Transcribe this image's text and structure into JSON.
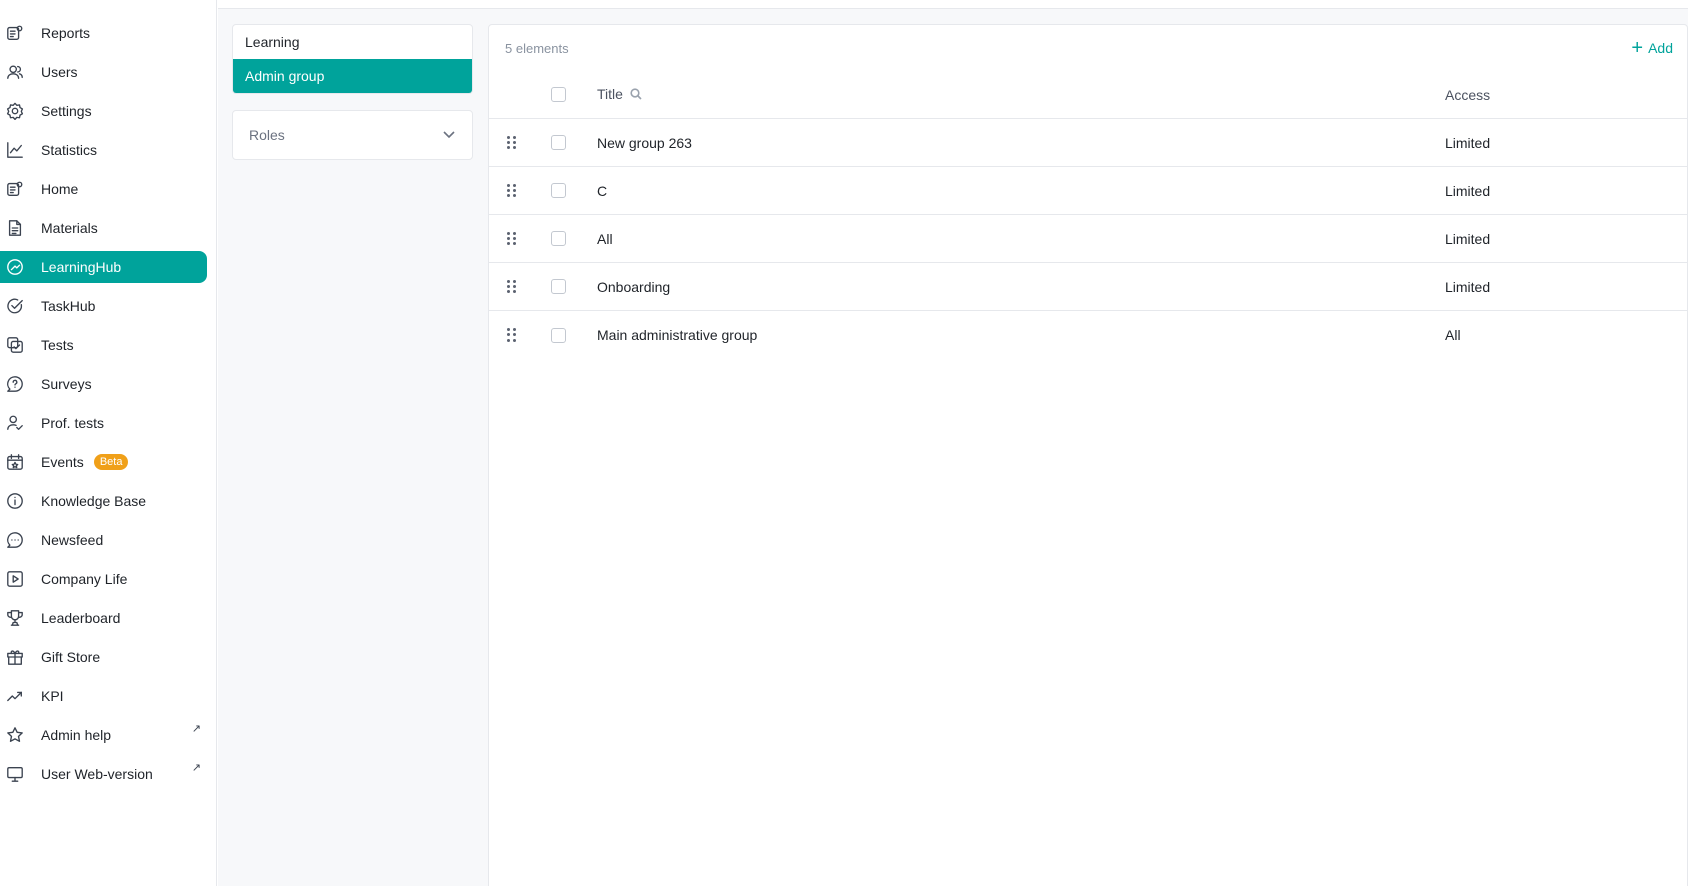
{
  "sidebar": {
    "items": [
      {
        "label": "Reports",
        "icon": "reports-icon"
      },
      {
        "label": "Users",
        "icon": "users-icon"
      },
      {
        "label": "Settings",
        "icon": "gear-icon"
      },
      {
        "label": "Statistics",
        "icon": "line-chart-icon"
      },
      {
        "label": "Home",
        "icon": "home-icon"
      },
      {
        "label": "Materials",
        "icon": "document-icon"
      },
      {
        "label": "LearningHub",
        "icon": "learninghub-icon",
        "active": true
      },
      {
        "label": "TaskHub",
        "icon": "check-circle-icon"
      },
      {
        "label": "Tests",
        "icon": "tests-icon"
      },
      {
        "label": "Surveys",
        "icon": "question-bubble-icon"
      },
      {
        "label": "Prof. tests",
        "icon": "user-check-icon"
      },
      {
        "label": "Events",
        "icon": "calendar-star-icon",
        "badge": "Beta"
      },
      {
        "label": "Knowledge Base",
        "icon": "info-icon"
      },
      {
        "label": "Newsfeed",
        "icon": "chat-bubble-icon"
      },
      {
        "label": "Company Life",
        "icon": "play-icon"
      },
      {
        "label": "Leaderboard",
        "icon": "trophy-icon"
      },
      {
        "label": "Gift Store",
        "icon": "gift-icon"
      },
      {
        "label": "KPI",
        "icon": "trend-up-icon"
      },
      {
        "label": "Admin help",
        "icon": "star-icon",
        "external": "↗"
      },
      {
        "label": "User Web-version",
        "icon": "monitor-icon",
        "external": "↗"
      }
    ]
  },
  "groups": {
    "items": [
      "Learning",
      "Admin group"
    ],
    "active_index": 1,
    "roles_label": "Roles"
  },
  "table": {
    "count_label": "5 elements",
    "add_label": "Add",
    "columns": {
      "title": "Title",
      "access": "Access"
    },
    "rows": [
      {
        "title": "New group 263",
        "access": "Limited"
      },
      {
        "title": "C",
        "access": "Limited"
      },
      {
        "title": "All",
        "access": "Limited"
      },
      {
        "title": "Onboarding",
        "access": "Limited"
      },
      {
        "title": "Main administrative group",
        "access": "All"
      }
    ]
  },
  "colors": {
    "accent": "#00a39b",
    "badge": "#f0a019"
  }
}
